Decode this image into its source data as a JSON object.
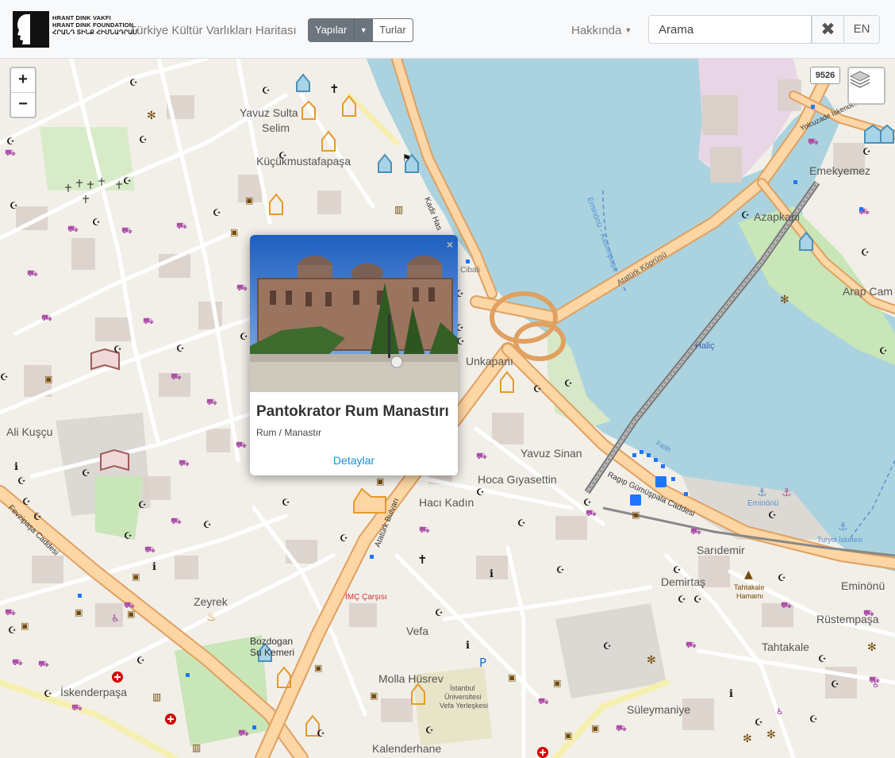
{
  "header": {
    "logo_lines": [
      "HRANT DINK VAKFI",
      "HRANT DINK FOUNDATION",
      "ՀՐԱՆԴ ՏԻՆՔ ՀԻՄՆԱԴՐԱՄ"
    ],
    "title": "Türkiye Kültür Varlıkları Haritası",
    "mode_buttons": {
      "active": "Yapılar",
      "other": "Turlar"
    },
    "about": "Hakkında",
    "search": {
      "value": "Arama",
      "placeholder": "Arama"
    },
    "lang": "EN"
  },
  "map": {
    "zoom_in": "+",
    "zoom_out": "−",
    "road_badge": "9526",
    "labels": {
      "yavuz_sultan_selim_1": "Yavuz Sulta",
      "yavuz_sultan_selim_2": "Selim",
      "kucukmustafapasa": "Küçükmustafapaşa",
      "ali_kuscu": "Ali Kuşçu",
      "unkapani": "Unkapanı",
      "yavuz_sinan": "Yavuz Sinan",
      "hoca_giyasettin": "Hoca Gıyasettin",
      "haci_kadin": "Hacı Kadın",
      "zeyrek": "Zeyrek",
      "vefa": "Vefa",
      "bozdogan_1": "Bozdogan",
      "bozdogan_2": "Su Kemeri",
      "molla_husrev": "Molla Hüsrev",
      "iskenderpasa": "İskenderpaşa",
      "kalenderhane": "Kalenderhane",
      "suleymaniye": "Süleymaniye",
      "saridemir": "Sarıdemir",
      "demirtas": "Demirtaş",
      "tahtakale": "Tahtakale",
      "rustempasa": "Rüstempaşa",
      "eminonu": "Eminönü",
      "eminonu_small": "Eminönü",
      "azapkapi": "Azapkapı",
      "emekyemez": "Emekyemez",
      "arap_cami": "Arap Cam",
      "halic": "Haliç",
      "cibali": "Cibali",
      "ataturk_koprusu": "Atatürk Köprüsü",
      "eminonu_kasimpasa": "Eminönü - Kasımpaşa",
      "ragip_gumuspala": "Ragıp Gümüşpala Caddesi",
      "ataturk_bulvari": "Atatürk Bulvarı",
      "fevzipasa": "Fevzipaşa Caddesi",
      "kadir_has": "Kadir Has",
      "imc_carsisi": "İMÇ Çarşısı",
      "istanbul_uni_1": "İstanbul",
      "istanbul_uni_2": "Üniversitesi",
      "istanbul_uni_3": "Vefa Yerleşkesi",
      "turyol": "Turyol İskelesi",
      "tahtakale_hamami_1": "Tahtakale",
      "tahtakale_hamami_2": "Hamamı",
      "fatih": "Fatih",
      "yolcuzade": "Yolcuzade İskender Caddesi"
    }
  },
  "popup": {
    "close": "×",
    "title": "Pantokrator Rum Manastırı",
    "subtitle": "Rum / Manastır",
    "link": "Detaylar"
  },
  "colors": {
    "water": "#aad3df",
    "land": "#f2efe9",
    "major_road": "#fcd6a4",
    "road_casing": "#e0a060",
    "monument_orange": "#e59a2a",
    "monument_blue": "#6fa8c6",
    "church_brown": "#a05a5a",
    "link_blue": "#1d8bd1"
  }
}
